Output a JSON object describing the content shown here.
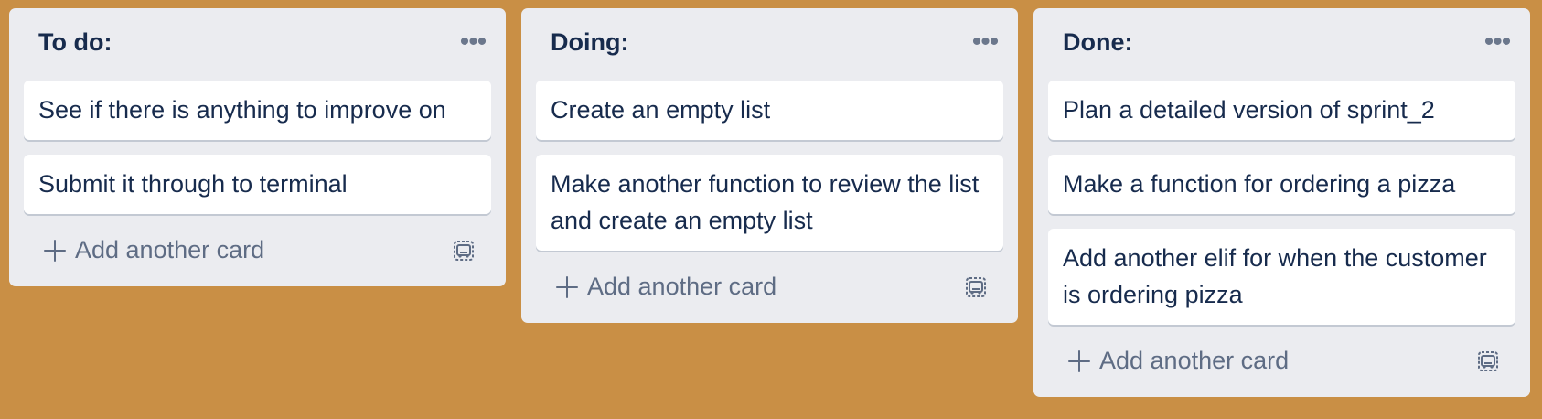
{
  "board": {
    "lists": [
      {
        "title": "To do:",
        "menu_icon": "more-horizontal-icon",
        "cards": [
          "See if there is anything to improve on",
          "Submit it through to terminal"
        ],
        "add_card_label": "Add another card",
        "template_icon": "card-template-icon"
      },
      {
        "title": "Doing:",
        "menu_icon": "more-horizontal-icon",
        "cards": [
          "Create an empty list",
          "Make another function to review the list and create an empty list"
        ],
        "add_card_label": "Add another card",
        "template_icon": "card-template-icon"
      },
      {
        "title": "Done:",
        "menu_icon": "more-horizontal-icon",
        "cards": [
          "Plan a detailed version of sprint_2",
          "Make a function for ordering a pizza",
          "Add another elif for when the customer is ordering pizza"
        ],
        "add_card_label": "Add another card",
        "template_icon": "card-template-icon"
      }
    ]
  },
  "colors": {
    "board_background": "#c98f45",
    "list_background": "#ebecf0",
    "card_background": "#ffffff",
    "text_primary": "#172b4d",
    "text_secondary": "#5e6c84"
  }
}
